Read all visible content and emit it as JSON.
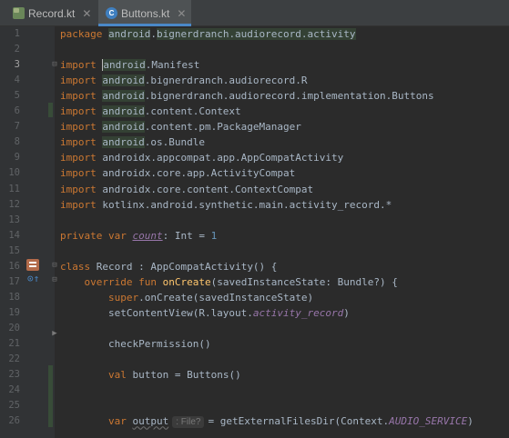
{
  "tabs": [
    {
      "label": "Record.kt",
      "icon": "kotlin-class-icon",
      "active": false
    },
    {
      "label": "Buttons.kt",
      "icon": "kotlin-class-icon",
      "active": true
    }
  ],
  "lines": [
    {
      "n": "1",
      "tokens": [
        [
          "kw",
          "package "
        ],
        [
          "pkgbg",
          "android"
        ],
        [
          "",
          "."
        ],
        [
          "pkgbg",
          "bignerdranch.audiorecord.activity"
        ]
      ]
    },
    {
      "n": "2",
      "tokens": []
    },
    {
      "n": "3",
      "tokens": [
        [
          "kw",
          "import "
        ],
        [
          "caret",
          ""
        ],
        [
          "pkgbg",
          "android"
        ],
        [
          "",
          ".Manifest"
        ]
      ],
      "current": true
    },
    {
      "n": "4",
      "tokens": [
        [
          "kw",
          "import "
        ],
        [
          "pkgbg",
          "android"
        ],
        [
          "",
          ".bignerdranch.audiorecord.R"
        ]
      ]
    },
    {
      "n": "5",
      "tokens": [
        [
          "kw",
          "import "
        ],
        [
          "pkgbg",
          "android"
        ],
        [
          "",
          ".bignerdranch.audiorecord.implementation.Buttons"
        ]
      ]
    },
    {
      "n": "6",
      "tokens": [
        [
          "kw",
          "import "
        ],
        [
          "pkgbg",
          "android"
        ],
        [
          "",
          ".content.Context"
        ]
      ]
    },
    {
      "n": "7",
      "tokens": [
        [
          "kw",
          "import "
        ],
        [
          "pkgbg",
          "android"
        ],
        [
          "",
          ".content.pm.PackageManager"
        ]
      ]
    },
    {
      "n": "8",
      "tokens": [
        [
          "kw",
          "import "
        ],
        [
          "pkgbg",
          "android"
        ],
        [
          "",
          ".os.Bundle"
        ]
      ]
    },
    {
      "n": "9",
      "tokens": [
        [
          "kw",
          "import "
        ],
        [
          "",
          "androidx.appcompat.app.AppCompatActivity"
        ]
      ]
    },
    {
      "n": "10",
      "tokens": [
        [
          "kw",
          "import "
        ],
        [
          "",
          "androidx.core.app.ActivityCompat"
        ]
      ]
    },
    {
      "n": "11",
      "tokens": [
        [
          "kw",
          "import "
        ],
        [
          "",
          "androidx.core.content.ContextCompat"
        ]
      ]
    },
    {
      "n": "12",
      "tokens": [
        [
          "kw",
          "import "
        ],
        [
          "",
          "kotlinx.android.synthetic.main.activity_record.*"
        ]
      ]
    },
    {
      "n": "13",
      "tokens": []
    },
    {
      "n": "14",
      "tokens": [
        [
          "kw",
          "private var "
        ],
        [
          "cnt",
          "count"
        ],
        [
          "",
          ": Int = "
        ],
        [
          "num",
          "1"
        ]
      ]
    },
    {
      "n": "15",
      "tokens": []
    },
    {
      "n": "16",
      "tokens": [
        [
          "kw",
          "class "
        ],
        [
          "",
          "Record : AppCompatActivity() {"
        ]
      ]
    },
    {
      "n": "17",
      "tokens": [
        [
          "",
          "    "
        ],
        [
          "kw",
          "override fun "
        ],
        [
          "fn",
          "onCreate"
        ],
        [
          "",
          "(savedInstanceState: Bundle?) {"
        ]
      ]
    },
    {
      "n": "18",
      "tokens": [
        [
          "",
          "        "
        ],
        [
          "kw",
          "super"
        ],
        [
          "",
          ".onCreate(savedInstanceState)"
        ]
      ]
    },
    {
      "n": "19",
      "tokens": [
        [
          "",
          "        setContentView(R.layout."
        ],
        [
          "propi",
          "activity_record"
        ],
        [
          "",
          ")"
        ]
      ]
    },
    {
      "n": "20",
      "tokens": []
    },
    {
      "n": "21",
      "tokens": [
        [
          "",
          "        checkPermission()"
        ]
      ]
    },
    {
      "n": "22",
      "tokens": []
    },
    {
      "n": "23",
      "tokens": [
        [
          "",
          "        "
        ],
        [
          "kw",
          "val "
        ],
        [
          "",
          "button = Buttons()"
        ]
      ]
    },
    {
      "n": "24",
      "tokens": []
    },
    {
      "n": "25",
      "tokens": []
    },
    {
      "n": "26",
      "tokens": [
        [
          "",
          "        "
        ],
        [
          "kw",
          "var "
        ],
        [
          "unused",
          "output"
        ],
        [
          "hint",
          ": File?"
        ],
        [
          "",
          "= getExternalFilesDir(Context."
        ],
        [
          "propi",
          "AUDIO_SERVICE"
        ],
        [
          "",
          ")"
        ]
      ]
    }
  ]
}
